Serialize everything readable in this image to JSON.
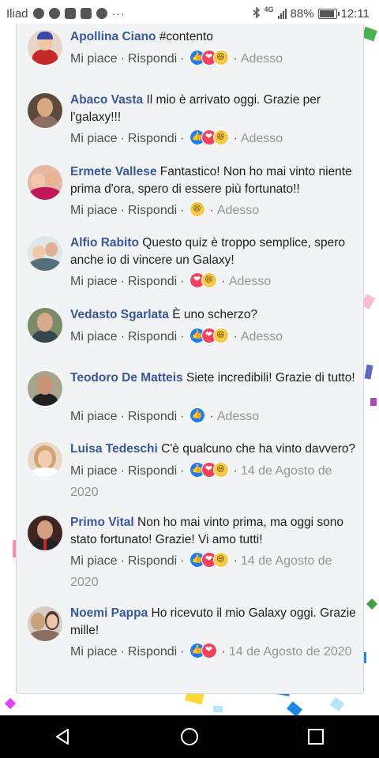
{
  "status_bar": {
    "carrier": "Iliad",
    "overflow": "···",
    "network": "4G",
    "battery": "88%",
    "time": "12:11"
  },
  "actions": {
    "like": "Mi piace",
    "reply": "Rispondi",
    "separator": "·"
  },
  "comments": [
    {
      "name": "Apollina Ciano",
      "text": "#contento",
      "reactions": [
        "like",
        "love",
        "haha"
      ],
      "time": "Adesso"
    },
    {
      "name": "Abaco Vasta",
      "text": "Il mio è arrivato oggi. Grazie per l'galaxy!!!",
      "reactions": [
        "like",
        "love",
        "haha"
      ],
      "time": "Adesso"
    },
    {
      "name": "Ermete Vallese",
      "text": "Fantastico! Non ho mai vinto niente prima d'ora, spero di essere più fortunato!!",
      "reactions": [
        "haha"
      ],
      "time": "Adesso"
    },
    {
      "name": "Alfio Rabito",
      "text": "Questo quiz è troppo semplice, spero anche io di vincere un Galaxy!",
      "reactions": [
        "love",
        "haha"
      ],
      "time": "Adesso"
    },
    {
      "name": "Vedasto Sgarlata",
      "text": "È uno scherzo?",
      "reactions": [
        "like",
        "love",
        "haha"
      ],
      "time": "Adesso"
    },
    {
      "name": "Teodoro De Matteis",
      "text": "Siete incredibili! Grazie di tutto!",
      "reactions": [
        "like"
      ],
      "time": "Adesso"
    },
    {
      "name": "Luisa Tedeschi",
      "text": "C'è qualcuno che ha vinto davvero?",
      "reactions": [
        "like",
        "love",
        "haha"
      ],
      "time": "14 de Agosto de 2020"
    },
    {
      "name": "Primo Vital",
      "text": "Non ho mai vinto prima, ma oggi sono stato fortunato! Grazie! Vi amo tutti!",
      "reactions": [
        "like",
        "love",
        "haha"
      ],
      "time": "14 de Agosto de 2020"
    },
    {
      "name": "Noemi Pappa",
      "text": "Ho ricevuto il mio Galaxy oggi. Grazie mille!",
      "reactions": [
        "like",
        "love"
      ],
      "time": "14 de Agosto de 2020"
    }
  ],
  "icons": {
    "reactions": {
      "like": "thumbs-up-icon",
      "love": "heart-icon",
      "haha": "laughing-face-icon"
    },
    "nav": [
      "back-icon",
      "home-icon",
      "recents-icon"
    ]
  },
  "colors": {
    "name": "#385898",
    "meta": "#90949c",
    "card_bg": "#f2f3f5",
    "like": "#1f7bf2",
    "love": "#f2415a",
    "haha": "#f7c948"
  }
}
